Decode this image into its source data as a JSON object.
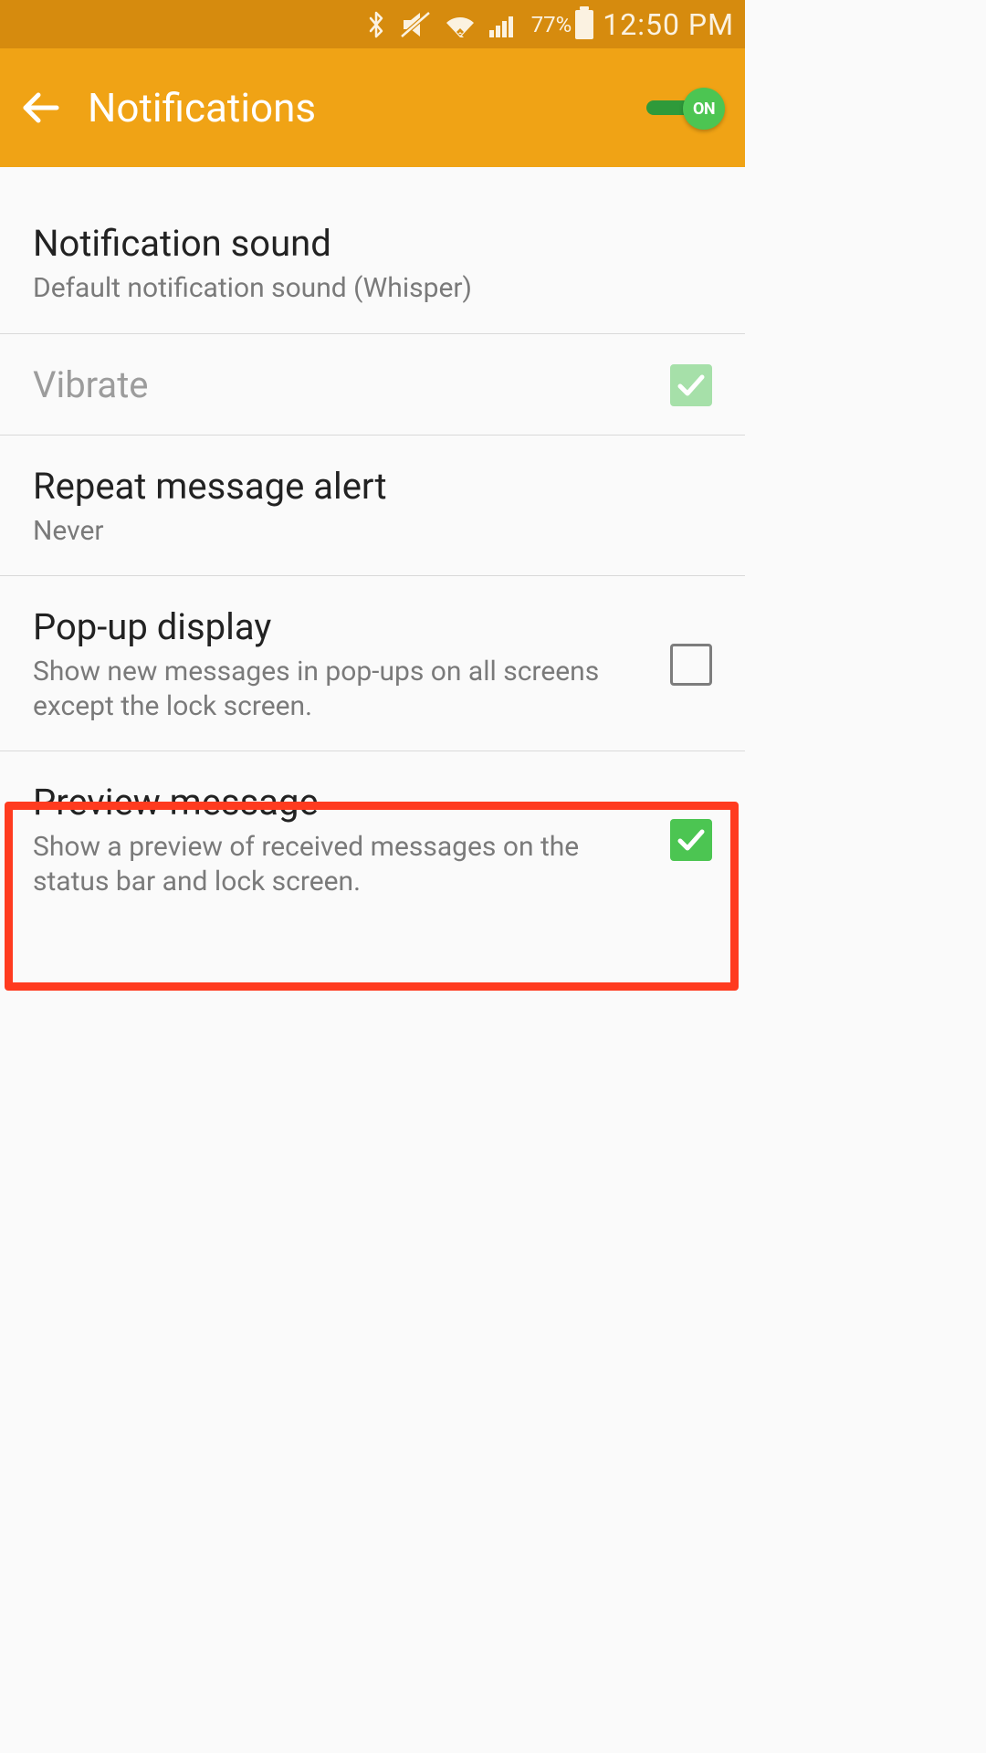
{
  "status": {
    "battery": "77%",
    "time": "12:50 PM"
  },
  "header": {
    "title": "Notifications",
    "toggle_label": "ON"
  },
  "items": {
    "sound": {
      "title": "Notification sound",
      "sub": "Default notification sound (Whisper)"
    },
    "vibrate": {
      "title": "Vibrate"
    },
    "repeat": {
      "title": "Repeat message alert",
      "sub": "Never"
    },
    "popup": {
      "title": "Pop-up display",
      "sub": "Show new messages in pop-ups on all screens except the lock screen."
    },
    "preview": {
      "title": "Preview message",
      "sub": "Show a preview of received messages on the status bar and lock screen."
    }
  }
}
